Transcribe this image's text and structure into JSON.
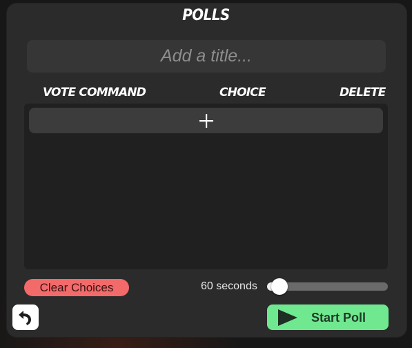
{
  "polls": {
    "title": "POLLS",
    "title_placeholder": "Add a title...",
    "columns": {
      "vote_command": "VOTE COMMAND",
      "choice": "CHOICE",
      "delete": "DELETE"
    },
    "add_choice_icon": "plus-icon",
    "clear_choices_label": "Clear Choices",
    "duration": {
      "label": "60 seconds",
      "slider_fraction": 0.1
    },
    "back_icon": "undo-arrow-icon",
    "start_poll_label": "Start Poll",
    "start_icon": "play-icon",
    "colors": {
      "panel": "#2b2b2b",
      "clear_button": "#f26a6a",
      "start_button": "#6fe88f"
    }
  }
}
